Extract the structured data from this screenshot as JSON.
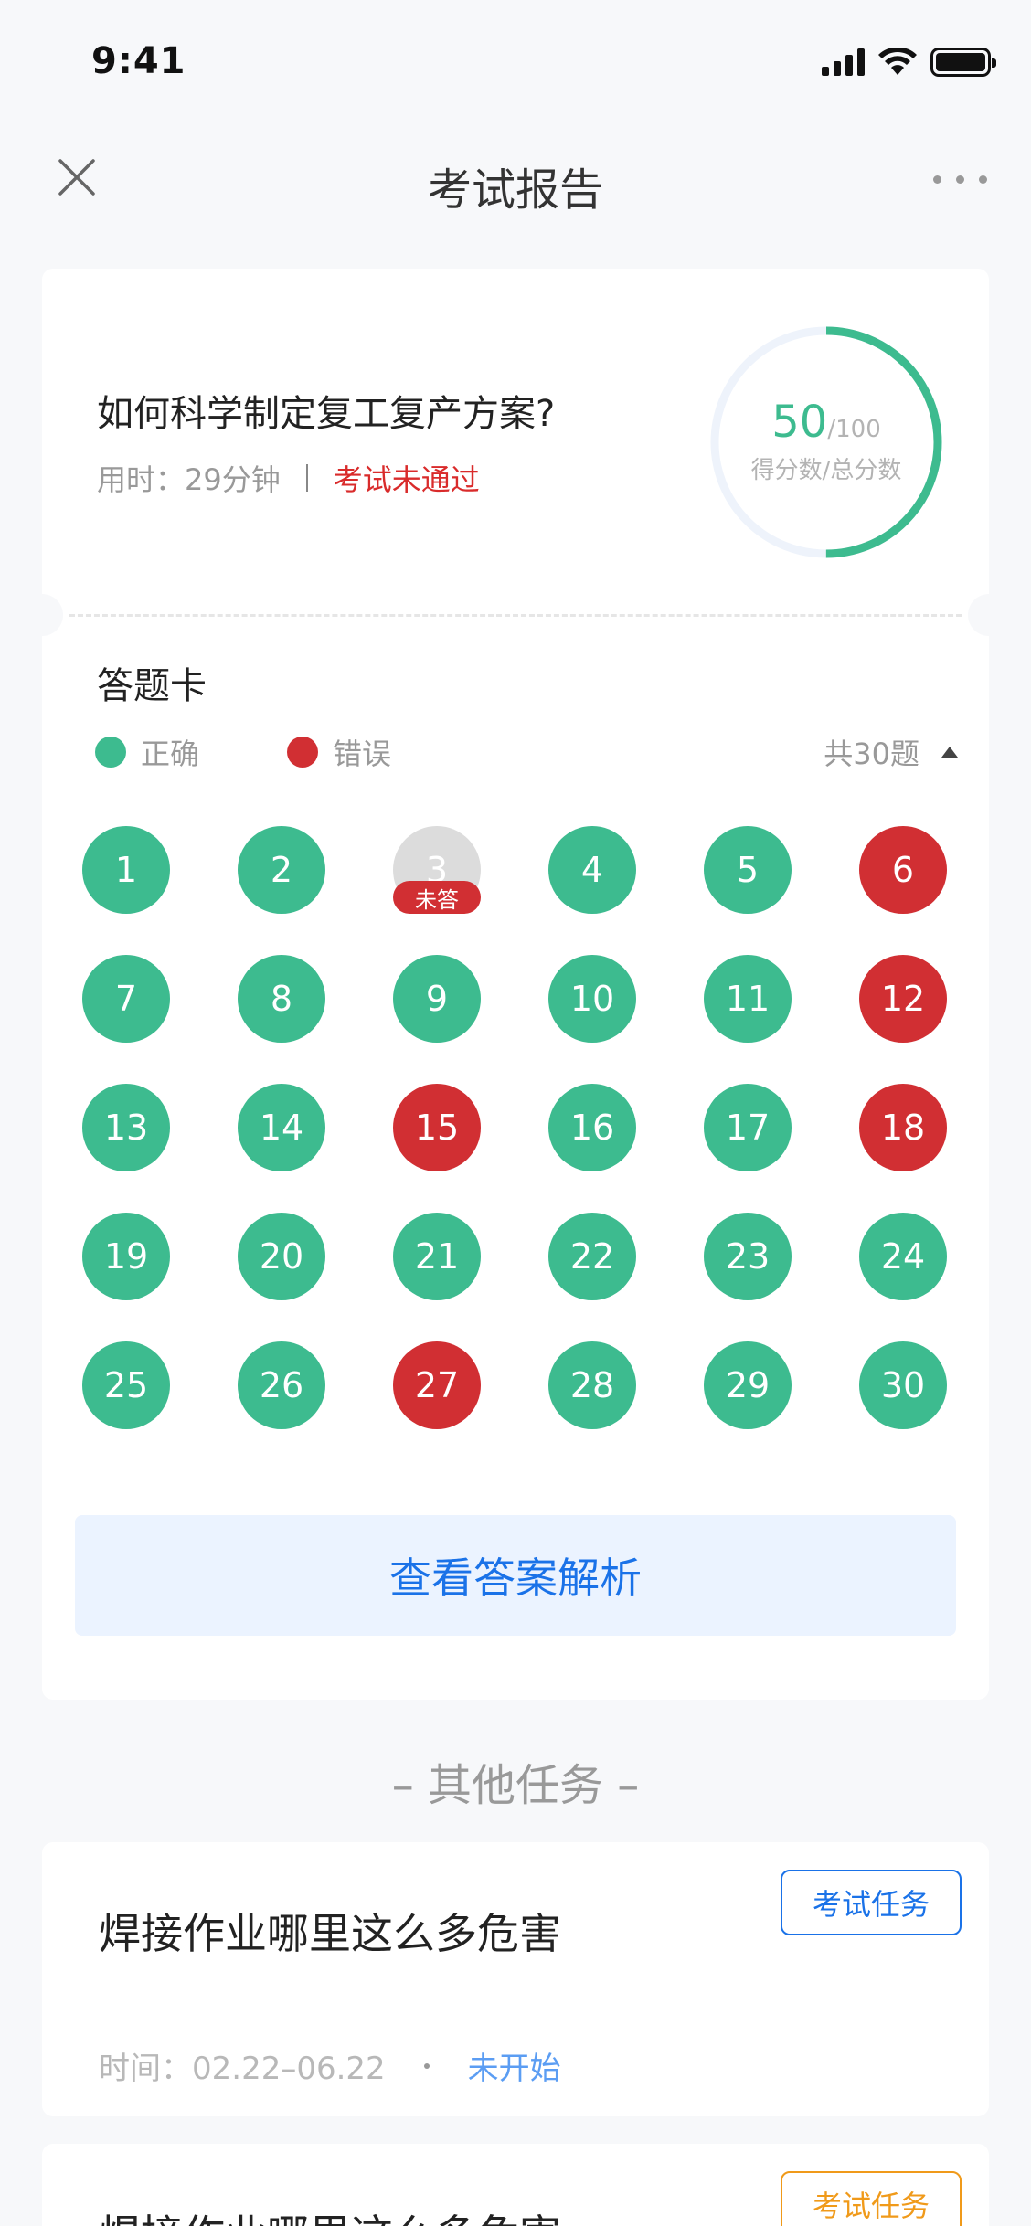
{
  "status_bar": {
    "time": "9:41"
  },
  "nav": {
    "title": "考试报告"
  },
  "report": {
    "exam_title": "如何科学制定复工复产方案?",
    "time_label": "用时：29分钟",
    "exam_status": "考试未通过",
    "score": {
      "value": "50",
      "total": "/100",
      "label": "得分数/总分数",
      "fraction": 0.5
    },
    "answer_card_title": "答题卡",
    "legend": {
      "correct": "正确",
      "wrong": "错误"
    },
    "total_count": "共30题",
    "unanswered_label": "未答",
    "questions": [
      {
        "num": "1",
        "status": "correct"
      },
      {
        "num": "2",
        "status": "correct"
      },
      {
        "num": "3",
        "status": "unanswered"
      },
      {
        "num": "4",
        "status": "correct"
      },
      {
        "num": "5",
        "status": "correct"
      },
      {
        "num": "6",
        "status": "wrong"
      },
      {
        "num": "7",
        "status": "correct"
      },
      {
        "num": "8",
        "status": "correct"
      },
      {
        "num": "9",
        "status": "correct"
      },
      {
        "num": "10",
        "status": "correct"
      },
      {
        "num": "11",
        "status": "correct"
      },
      {
        "num": "12",
        "status": "wrong"
      },
      {
        "num": "13",
        "status": "correct"
      },
      {
        "num": "14",
        "status": "correct"
      },
      {
        "num": "15",
        "status": "wrong"
      },
      {
        "num": "16",
        "status": "correct"
      },
      {
        "num": "17",
        "status": "correct"
      },
      {
        "num": "18",
        "status": "wrong"
      },
      {
        "num": "19",
        "status": "correct"
      },
      {
        "num": "20",
        "status": "correct"
      },
      {
        "num": "21",
        "status": "correct"
      },
      {
        "num": "22",
        "status": "correct"
      },
      {
        "num": "23",
        "status": "correct"
      },
      {
        "num": "24",
        "status": "correct"
      },
      {
        "num": "25",
        "status": "correct"
      },
      {
        "num": "26",
        "status": "correct"
      },
      {
        "num": "27",
        "status": "wrong"
      },
      {
        "num": "28",
        "status": "correct"
      },
      {
        "num": "29",
        "status": "correct"
      },
      {
        "num": "30",
        "status": "correct"
      }
    ],
    "view_answers_label": "查看答案解析"
  },
  "other_tasks": {
    "section_title": "– 其他任务 –",
    "tasks": [
      {
        "title": "焊接作业哪里这么多危害",
        "badge": "考试任务",
        "time": "时间：02.22–06.22",
        "status": "未开始"
      },
      {
        "title": "焊接作业哪里这么多危害",
        "badge": "考试任务"
      }
    ]
  },
  "colors": {
    "correct": "#3dbb8f",
    "wrong": "#d12f33",
    "accent_blue": "#1a72e8",
    "accent_orange": "#f09a1a"
  },
  "icons": [
    "signal-icon",
    "wifi-icon",
    "battery-icon",
    "close-icon",
    "more-icon",
    "collapse-icon"
  ]
}
